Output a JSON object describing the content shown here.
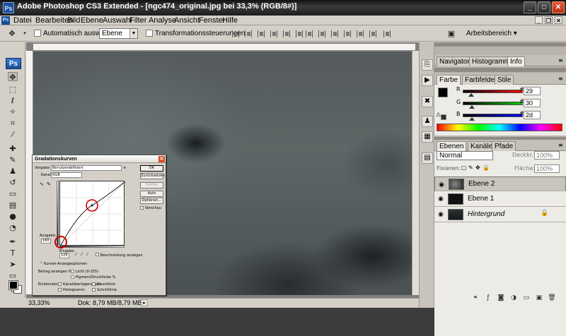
{
  "window": {
    "title": "Adobe Photoshop CS3 Extended - [ngc474_original.jpg bei 33,3% (RGB/8#)]",
    "app_icon": "Ps",
    "buttons": {
      "minimize": "_",
      "maximize": "□",
      "close": "✕"
    }
  },
  "menubar": {
    "items": [
      "Datei",
      "Bearbeiten",
      "Bild",
      "Ebene",
      "Auswahl",
      "Filter",
      "Analyse",
      "Ansicht",
      "Fenster",
      "Hilfe"
    ],
    "doc_buttons": {
      "minimize": "_",
      "restore": "❐",
      "close": "✕"
    }
  },
  "options": {
    "auto_select_label": "Automatisch auswählen:",
    "auto_select_value": "Ebene",
    "transform_label": "Transformationssteuerungen",
    "workspace_label": "Arbeitsbereich ▾"
  },
  "toolbox": {
    "logo": "Ps",
    "tools": [
      "move-tool",
      "marquee-tool",
      "lasso-tool",
      "magic-wand-tool",
      "crop-tool",
      "eyedropper-tool",
      "healing-brush-tool",
      "brush-tool",
      "clone-stamp-tool",
      "history-brush-tool",
      "eraser-tool",
      "gradient-tool",
      "blur-tool",
      "dodge-tool",
      "pen-tool",
      "type-tool",
      "path-selection-tool",
      "shape-tool",
      "notes-tool",
      "hand-tool",
      "zoom-tool"
    ]
  },
  "status": {
    "zoom": "33,33%",
    "doc_info": "Dok: 8,79 MB/8,79 MB"
  },
  "curves_dialog": {
    "title": "Gradationskurven",
    "preset_label": "Vorgabe:",
    "preset_value": "Benutzerdefiniert",
    "channel_label": "Kanal:",
    "channel_value": "RGB",
    "buttons": [
      "OK",
      "Zurücksetzen",
      "Glätten",
      "Auto",
      "Optionen..."
    ],
    "preview_label": "Vorschau",
    "output_label": "Ausgabe:",
    "output_value": "160",
    "input_label": "Eingabe:",
    "input_value": "125",
    "clipping_label": "Beschneidung anzeigen",
    "options_header": "Kurven-Anzeigeoptionen",
    "amount_label": "Betrag anzeigen für:",
    "light_label": "Licht (0-255)",
    "pigment_label": "Pigment/Druckfarbe %",
    "show_label": "Einblenden:",
    "show_options": [
      "Kanalüberlagerungen",
      "Grundlinie",
      "Histogramm",
      "Schnittlinie"
    ]
  },
  "panels": {
    "info_tabs": [
      "Navigator",
      "Histogramm",
      "Info"
    ],
    "color_tabs": [
      "Farbe",
      "Farbfelder",
      "Stile"
    ],
    "color": {
      "r_label": "R",
      "g_label": "G",
      "b_label": "B",
      "r": "29",
      "g": "30",
      "b": "2d"
    },
    "layers_tabs": [
      "Ebenen",
      "Kanäle",
      "Pfade"
    ],
    "blend_mode": "Normal",
    "opacity_label": "Deckkr.:",
    "opacity": "100%",
    "lock_label": "Fixieren:",
    "fill_label": "Fläche:",
    "fill": "100%",
    "layers": [
      "Ebene 2",
      "Ebene 1",
      "Hintergrund"
    ]
  },
  "colors": {
    "accent": "#1b4f9a",
    "close_red": "#d84a2a",
    "fg_swatch": "#000000",
    "color_swatch": "#29302d"
  }
}
